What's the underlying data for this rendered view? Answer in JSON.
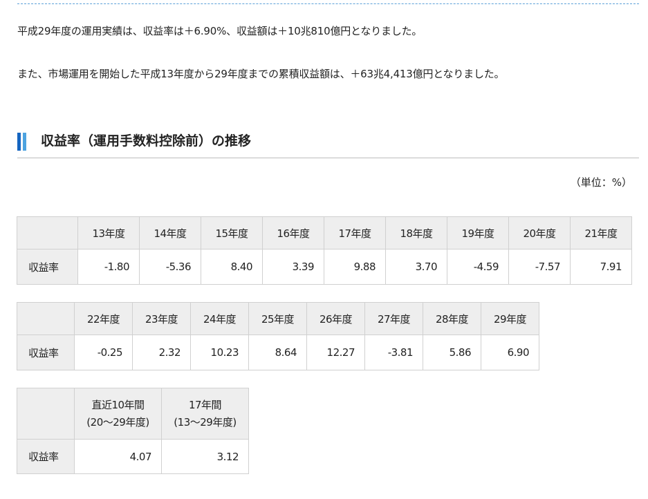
{
  "intro": {
    "line1": "平成29年度の運用実績は、収益率は＋6.90%、収益額は＋10兆810億円となりました。",
    "line2": "また、市場運用を開始した平成13年度から29年度までの累積収益額は、＋63兆4,413億円となりました。"
  },
  "section": {
    "title": "収益率（運用手数料控除前）の推移",
    "unit": "（単位：%）"
  },
  "row_label": "収益率",
  "table1": {
    "headers": [
      "13年度",
      "14年度",
      "15年度",
      "16年度",
      "17年度",
      "18年度",
      "19年度",
      "20年度",
      "21年度"
    ],
    "values": [
      "-1.80",
      "-5.36",
      "8.40",
      "3.39",
      "9.88",
      "3.70",
      "-4.59",
      "-7.57",
      "7.91"
    ]
  },
  "table2": {
    "headers": [
      "22年度",
      "23年度",
      "24年度",
      "25年度",
      "26年度",
      "27年度",
      "28年度",
      "29年度"
    ],
    "values": [
      "-0.25",
      "2.32",
      "10.23",
      "8.64",
      "12.27",
      "-3.81",
      "5.86",
      "6.90"
    ]
  },
  "table3": {
    "headers": [
      {
        "line1": "直近10年間",
        "line2": "(20～29年度)"
      },
      {
        "line1": "17年間",
        "line2": "(13～29年度)"
      }
    ],
    "values": [
      "4.07",
      "3.12"
    ]
  }
}
